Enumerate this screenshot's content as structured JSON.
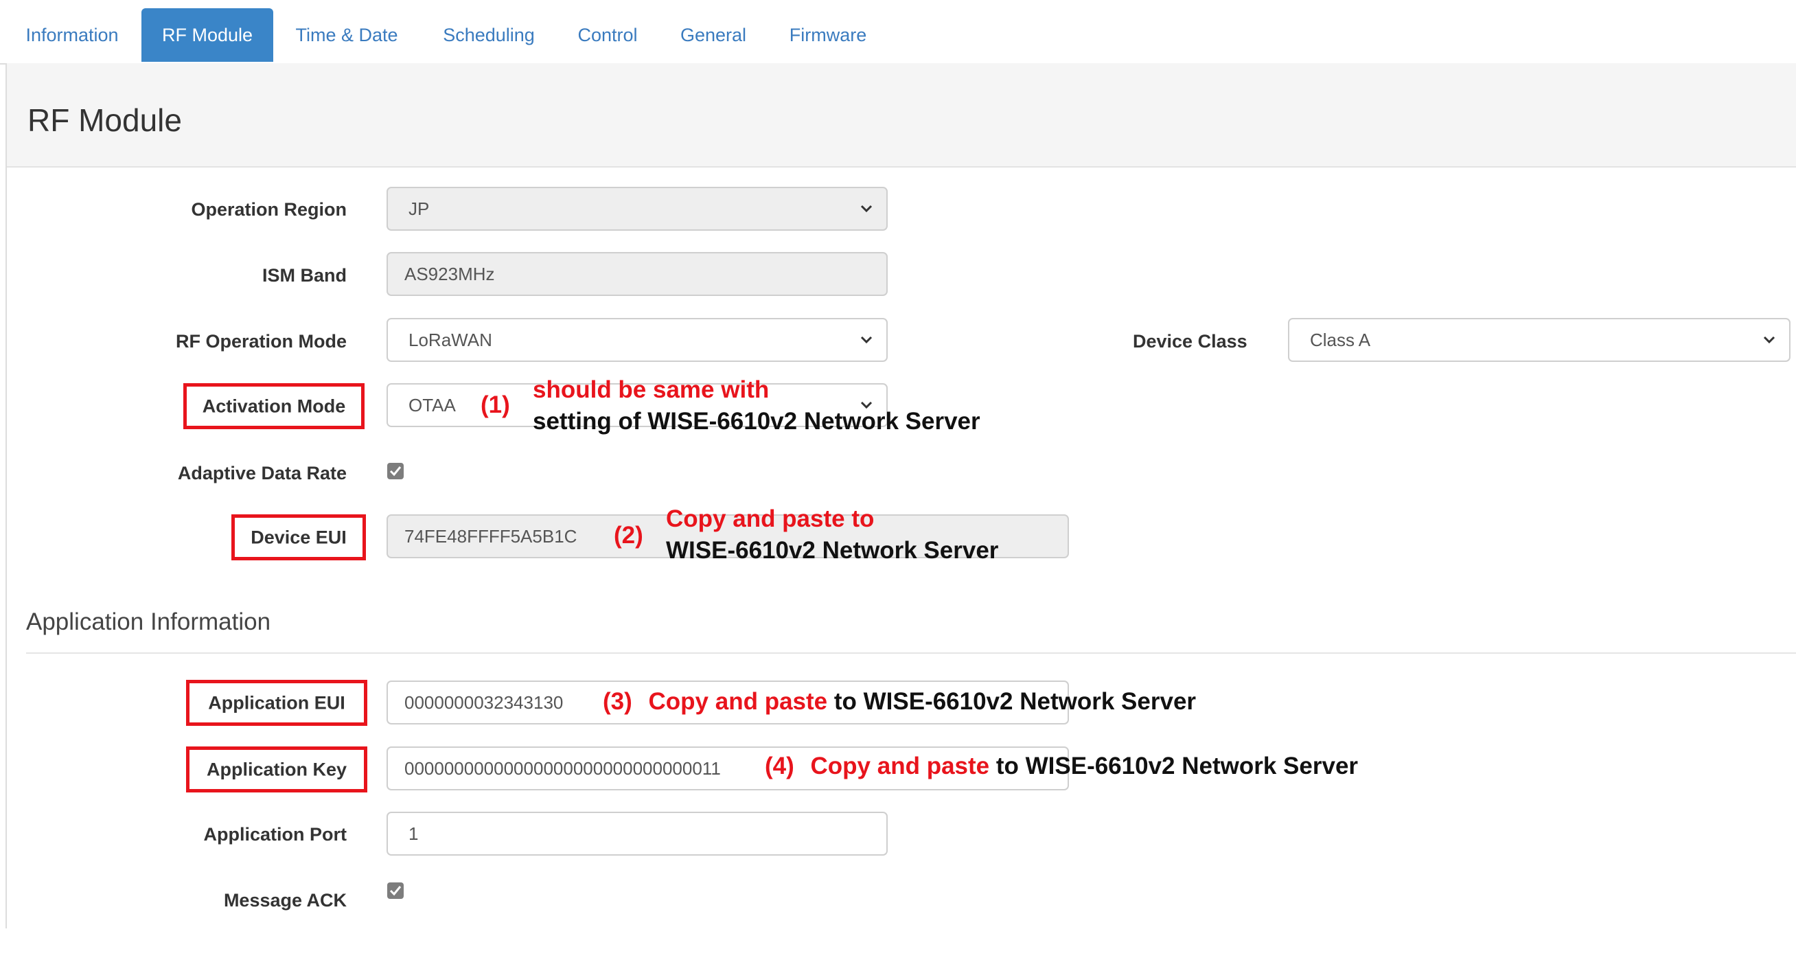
{
  "tabs": [
    {
      "label": "Information"
    },
    {
      "label": "RF Module"
    },
    {
      "label": "Time & Date"
    },
    {
      "label": "Scheduling"
    },
    {
      "label": "Control"
    },
    {
      "label": "General"
    },
    {
      "label": "Firmware"
    }
  ],
  "panel": {
    "title": "RF Module"
  },
  "form": {
    "operation_region": {
      "label": "Operation Region",
      "value": "JP"
    },
    "ism_band": {
      "label": "ISM Band",
      "value": "AS923MHz"
    },
    "rf_operation_mode": {
      "label": "RF Operation Mode",
      "value": "LoRaWAN"
    },
    "device_class": {
      "label": "Device Class",
      "value": "Class A"
    },
    "activation_mode": {
      "label": "Activation Mode",
      "value": "OTAA"
    },
    "adaptive_data_rate": {
      "label": "Adaptive Data Rate",
      "checked": true
    },
    "device_eui": {
      "label": "Device EUI",
      "value": "74FE48FFFF5A5B1C"
    }
  },
  "application": {
    "section_title": "Application Information",
    "app_eui": {
      "label": "Application EUI",
      "value": "0000000032343130"
    },
    "app_key": {
      "label": "Application Key",
      "value": "00000000000000000000000000000011"
    },
    "app_port": {
      "label": "Application Port",
      "value": "1"
    },
    "message_ack": {
      "label": "Message ACK",
      "checked": true
    }
  },
  "annotations": {
    "a1": {
      "num": "(1)",
      "line1": "should be same with",
      "line2": "setting of WISE-6610v2 Network Server"
    },
    "a2": {
      "num": "(2)",
      "line1": "Copy and paste to",
      "line2": "WISE-6610v2 Network Server"
    },
    "a3": {
      "num": "(3)",
      "red": "Copy and paste",
      "black": "to WISE-6610v2 Network Server"
    },
    "a4": {
      "num": "(4)",
      "red": "Copy and paste",
      "black": "to WISE-6610v2 Network Server"
    }
  },
  "colors": {
    "accent": "#3a85c8",
    "annotation_red": "#e8141c"
  }
}
